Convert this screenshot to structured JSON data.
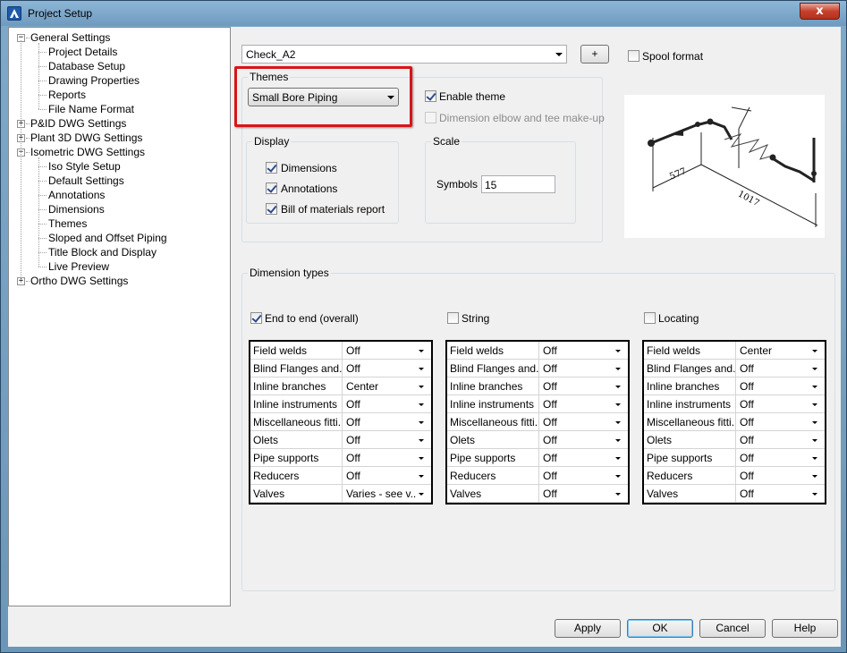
{
  "window": {
    "title": "Project Setup",
    "close_glyph": "x"
  },
  "tree": {
    "items": [
      {
        "label": "General Settings",
        "level": 0,
        "expander": "−"
      },
      {
        "label": "Project Details",
        "level": 1
      },
      {
        "label": "Database Setup",
        "level": 1
      },
      {
        "label": "Drawing Properties",
        "level": 1
      },
      {
        "label": "Reports",
        "level": 1
      },
      {
        "label": "File Name Format",
        "level": 1
      },
      {
        "label": "P&ID DWG Settings",
        "level": 0,
        "expander": "+"
      },
      {
        "label": "Plant 3D DWG Settings",
        "level": 0,
        "expander": "+"
      },
      {
        "label": "Isometric DWG Settings",
        "level": 0,
        "expander": "−"
      },
      {
        "label": "Iso Style Setup",
        "level": 1
      },
      {
        "label": "Default Settings",
        "level": 1
      },
      {
        "label": "Annotations",
        "level": 1
      },
      {
        "label": "Dimensions",
        "level": 1
      },
      {
        "label": "Themes",
        "level": 1,
        "selected": true
      },
      {
        "label": "Sloped and Offset Piping",
        "level": 1
      },
      {
        "label": "Title Block and Display",
        "level": 1
      },
      {
        "label": "Live Preview",
        "level": 1
      },
      {
        "label": "Ortho DWG Settings",
        "level": 0,
        "expander": "+"
      }
    ]
  },
  "style_combo": {
    "value": "Check_A2"
  },
  "add_button": {
    "label": "+"
  },
  "spool_format": {
    "label": "Spool format",
    "checked": false
  },
  "themes": {
    "title": "Themes",
    "combo_value": "Small Bore Piping",
    "enable_theme": {
      "label": "Enable theme",
      "checked": true
    },
    "dimension_elbow": {
      "label": "Dimension elbow and tee make-up",
      "checked": false,
      "disabled": true
    }
  },
  "display": {
    "title": "Display",
    "dimensions": {
      "label": "Dimensions",
      "checked": true
    },
    "annotations": {
      "label": "Annotations",
      "checked": true
    },
    "bom": {
      "label": "Bill of materials report",
      "checked": true
    }
  },
  "scale": {
    "title": "Scale",
    "symbols_label": "Symbols",
    "symbols_value": "15"
  },
  "preview": {
    "dim1": "577",
    "dim2": "1017"
  },
  "dimension_types": {
    "title": "Dimension types",
    "columns": [
      {
        "label": "End to end (overall)",
        "checked": true,
        "rows": [
          {
            "name": "Field welds",
            "value": "Off"
          },
          {
            "name": "Blind Flanges and...",
            "value": "Off"
          },
          {
            "name": "Inline branches",
            "value": "Center"
          },
          {
            "name": "Inline instruments",
            "value": "Off"
          },
          {
            "name": "Miscellaneous fitti...",
            "value": "Off"
          },
          {
            "name": "Olets",
            "value": "Off"
          },
          {
            "name": "Pipe supports",
            "value": "Off"
          },
          {
            "name": "Reducers",
            "value": "Off"
          },
          {
            "name": "Valves",
            "value": "Varies - see v..."
          }
        ]
      },
      {
        "label": "String",
        "checked": false,
        "rows": [
          {
            "name": "Field welds",
            "value": "Off"
          },
          {
            "name": "Blind Flanges and...",
            "value": "Off"
          },
          {
            "name": "Inline branches",
            "value": "Off"
          },
          {
            "name": "Inline instruments",
            "value": "Off"
          },
          {
            "name": "Miscellaneous fitti...",
            "value": "Off"
          },
          {
            "name": "Olets",
            "value": "Off"
          },
          {
            "name": "Pipe supports",
            "value": "Off"
          },
          {
            "name": "Reducers",
            "value": "Off"
          },
          {
            "name": "Valves",
            "value": "Off"
          }
        ]
      },
      {
        "label": "Locating",
        "checked": false,
        "rows": [
          {
            "name": "Field welds",
            "value": "Center"
          },
          {
            "name": "Blind Flanges and...",
            "value": "Off"
          },
          {
            "name": "Inline branches",
            "value": "Off"
          },
          {
            "name": "Inline instruments",
            "value": "Off"
          },
          {
            "name": "Miscellaneous fitti...",
            "value": "Off"
          },
          {
            "name": "Olets",
            "value": "Off"
          },
          {
            "name": "Pipe supports",
            "value": "Off"
          },
          {
            "name": "Reducers",
            "value": "Off"
          },
          {
            "name": "Valves",
            "value": "Off"
          }
        ]
      }
    ]
  },
  "footer": {
    "apply": "Apply",
    "ok": "OK",
    "cancel": "Cancel",
    "help": "Help"
  },
  "colors": {
    "highlight": "#d9141a",
    "accent": "#3c7fb1"
  }
}
